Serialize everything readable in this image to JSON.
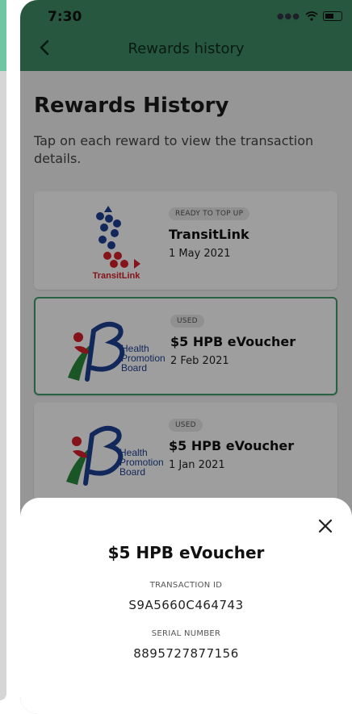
{
  "status_bar": {
    "time": "7:30"
  },
  "header": {
    "title": "Rewards history"
  },
  "page": {
    "title": "Rewards History",
    "description": "Tap on each reward to view the transaction details."
  },
  "rewards": [
    {
      "status": "READY TO TOP UP",
      "title": "TransitLink",
      "date": "1 May 2021",
      "logo_text": "TransitLink"
    },
    {
      "status": "USED",
      "title": "$5 HPB eVoucher",
      "date": "2 Feb 2021",
      "logo_text": [
        "Health",
        "Promotion",
        "Board"
      ]
    },
    {
      "status": "USED",
      "title": "$5 HPB eVoucher",
      "date": "1 Jan 2021",
      "logo_text": [
        "Health",
        "Promotion",
        "Board"
      ]
    }
  ],
  "sheet": {
    "title": "$5 HPB eVoucher",
    "transaction_label": "TRANSACTION ID",
    "transaction_id": "S9A5660C464743",
    "serial_label": "SERIAL NUMBER",
    "serial_number": "8895727877156"
  },
  "colors": {
    "header": "#3f8e66",
    "selected_border": "#3f9b6d",
    "transitlink_red": "#d7202a",
    "transitlink_blue": "#1d3f91"
  },
  "icons": {
    "back": "chevron-left-icon",
    "close": "close-icon",
    "signal": "signal-dots-icon",
    "wifi": "wifi-icon",
    "battery": "battery-icon"
  }
}
